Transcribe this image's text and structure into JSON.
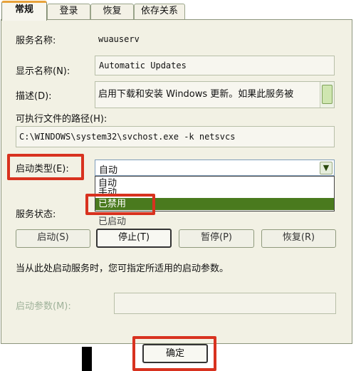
{
  "tabs": [
    "常规",
    "登录",
    "恢复",
    "依存关系"
  ],
  "service_name_label": "服务名称:",
  "service_name_value": "wuauserv",
  "display_name_label": "显示名称(N):",
  "display_name_value": "Automatic Updates",
  "description_label": "描述(D):",
  "description_value": "启用下载和安装 Windows 更新。如果此服务被",
  "exe_path_label": "可执行文件的路径(H):",
  "exe_path_value": "C:\\WINDOWS\\system32\\svchost.exe -k netsvcs",
  "startup_type_label": "启动类型(E):",
  "startup_type_selected": "自动",
  "startup_options": [
    "自动",
    "手动",
    "已禁用"
  ],
  "service_status_label": "服务状态:",
  "service_status_value": "已启动",
  "buttons": {
    "start": "启动(S)",
    "stop": "停止(T)",
    "pause": "暂停(P)",
    "resume": "恢复(R)"
  },
  "hint_text": "当从此处启动服务时，您可指定所适用的启动参数。",
  "start_params_label": "启动参数(M):",
  "start_params_value": "",
  "ok_button": "确定",
  "colors": {
    "highlight_red": "#d8321f",
    "selected_green": "#4a7a1e",
    "tab_accent": "#e8a23a"
  }
}
